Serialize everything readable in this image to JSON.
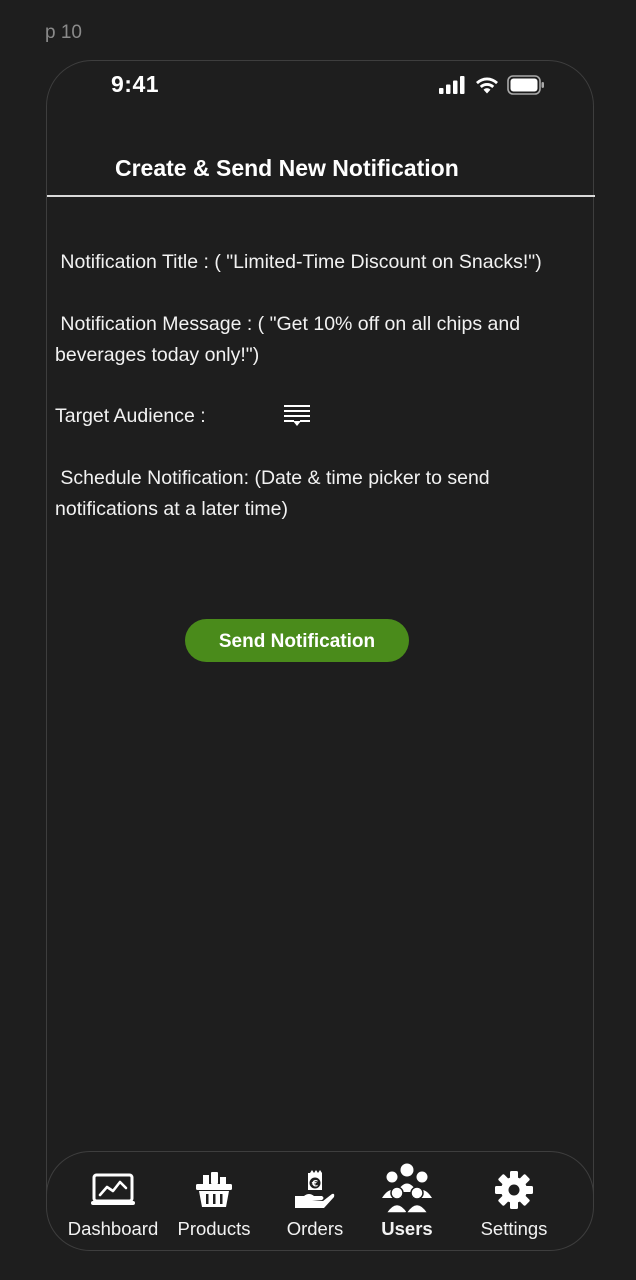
{
  "frame_label": "p 10",
  "status_bar": {
    "time": "9:41"
  },
  "header": {
    "title": "Create & Send New Notification"
  },
  "form": {
    "title_field": " Notification Title : ( \"Limited-Time Discount on Snacks!\")",
    "message_field": " Notification Message : ( \"Get 10% off on all chips and beverages today only!\")",
    "audience_label": "Target Audience :",
    "audience_icon": "filter-list-icon",
    "schedule_field": " Schedule Notification: (Date & time picker to send notifications at a later time)"
  },
  "actions": {
    "send_label": "Send Notification",
    "send_color": "#4a8b1b"
  },
  "tabbar": {
    "active": "Users",
    "items": [
      {
        "label": "Dashboard",
        "icon": "chart-monitor-icon"
      },
      {
        "label": "Products",
        "icon": "basket-icon"
      },
      {
        "label": "Orders",
        "icon": "hand-money-icon"
      },
      {
        "label": "Users",
        "icon": "users-group-icon"
      },
      {
        "label": "Settings",
        "icon": "gear-icon"
      }
    ]
  },
  "colors": {
    "background": "#1e1e1e",
    "text": "#ffffff",
    "divider": "#d9d9d9"
  }
}
